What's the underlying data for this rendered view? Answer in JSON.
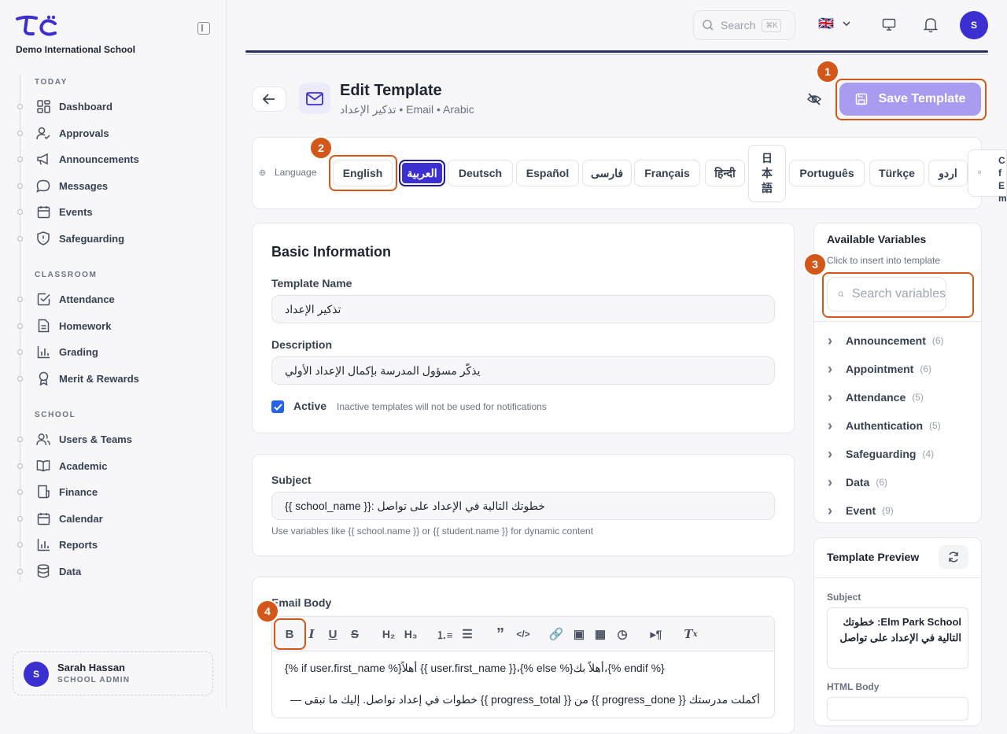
{
  "app": {
    "school_name": "Demo International School",
    "logo": "tc-logo"
  },
  "sidebar": {
    "sections": [
      {
        "label": "TODAY"
      },
      {
        "label": "CLASSROOM"
      },
      {
        "label": "SCHOOL"
      }
    ],
    "items": [
      {
        "label": "Dashboard",
        "icon": "grid-icon"
      },
      {
        "label": "Approvals",
        "icon": "user-check-icon"
      },
      {
        "label": "Announcements",
        "icon": "megaphone-icon"
      },
      {
        "label": "Messages",
        "icon": "chat-icon"
      },
      {
        "label": "Events",
        "icon": "calendar-icon"
      },
      {
        "label": "Safeguarding",
        "icon": "shield-icon"
      },
      {
        "label": "Attendance",
        "icon": "check-square-icon"
      },
      {
        "label": "Homework",
        "icon": "document-icon"
      },
      {
        "label": "Grading",
        "icon": "bar-chart-icon"
      },
      {
        "label": "Merit & Rewards",
        "icon": "award-icon"
      },
      {
        "label": "Users & Teams",
        "icon": "users-icon"
      },
      {
        "label": "Academic",
        "icon": "book-icon"
      },
      {
        "label": "Finance",
        "icon": "receipt-icon"
      },
      {
        "label": "Calendar",
        "icon": "calendar-icon"
      },
      {
        "label": "Reports",
        "icon": "bar-chart-icon"
      },
      {
        "label": "Data",
        "icon": "database-icon"
      }
    ],
    "user": {
      "initial": "S",
      "name": "Sarah Hassan",
      "role": "SCHOOL ADMIN"
    }
  },
  "topbar": {
    "search_placeholder": "Search",
    "shortcut": "⌘K",
    "flag": "🇬🇧",
    "avatar_initial": "S"
  },
  "header": {
    "title": "Edit Template",
    "subtitle": "تذكير الإعداد • Email • Arabic",
    "save_label": "Save Template"
  },
  "language": {
    "label": "Language",
    "options": [
      "English",
      "العربية",
      "Deutsch",
      "Español",
      "فارسی",
      "Français",
      "हिन्दी",
      "日本語",
      "Português",
      "Türkçe",
      "اردو"
    ],
    "selected": "العربية",
    "overflow_text": "C f Em"
  },
  "basic_info": {
    "heading": "Basic Information",
    "name_label": "Template Name",
    "name_value": "تذكير الإعداد",
    "desc_label": "Description",
    "desc_value": "يذكّر مسؤول المدرسة بإكمال الإعداد الأولي",
    "active_label": "Active",
    "active_hint": "Inactive templates will not be used for notifications",
    "active_checked": true
  },
  "subject": {
    "label": "Subject",
    "value": "{{ school_name }}: خطوتك التالية في الإعداد على تواصل",
    "hint": "Use variables like {{ school.name }} or {{ student.name }} for dynamic content"
  },
  "email_body": {
    "label": "Email Body",
    "line1": "{% if user.first_name %}أهلاً {{ user.first_name }}،{% else %}أهلاً بك،{% endif %}",
    "line2": "أكملت مدرستك {{ progress_done }} من {{ progress_total }} خطوات في إعداد تواصل. إليك ما تبقى —"
  },
  "variables": {
    "heading": "Available Variables",
    "hint": "Click to insert into template",
    "search_placeholder": "Search variables",
    "groups": [
      {
        "name": "Announcement",
        "count": "(6)"
      },
      {
        "name": "Appointment",
        "count": "(6)"
      },
      {
        "name": "Attendance",
        "count": "(5)"
      },
      {
        "name": "Authentication",
        "count": "(5)"
      },
      {
        "name": "Safeguarding",
        "count": "(4)"
      },
      {
        "name": "Data",
        "count": "(6)"
      },
      {
        "name": "Event",
        "count": "(9)"
      }
    ]
  },
  "preview": {
    "heading": "Template Preview",
    "subject_label": "Subject",
    "subject_value": "Elm Park School: خطوتك التالية في الإعداد على تواصل",
    "html_label": "HTML Body"
  },
  "annotations": [
    "1",
    "2",
    "3",
    "4"
  ],
  "colors": {
    "accent": "#3b2fd1",
    "highlight": "#d4571a",
    "save_button": "#a99cf0"
  }
}
